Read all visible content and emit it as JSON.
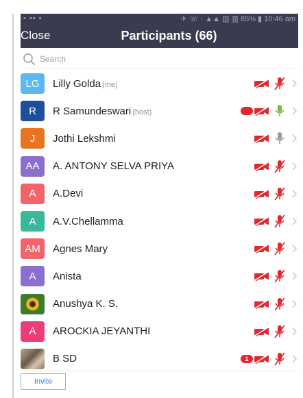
{
  "status_bar": {
    "left": "▪ ▪▪ ▪",
    "right": "✈ ☏ · ▲▲ ▥ ▥ 85% ▮ 10:46 am"
  },
  "header": {
    "close_label": "Close",
    "title": "Participants (66)"
  },
  "search": {
    "placeholder": "Search",
    "icon": "search-icon"
  },
  "colors": {
    "header_bg": "#3b3b4f",
    "muted_red": "#e5262f",
    "unmuted_gray": "#9a9a9a",
    "unmuted_green": "#7ab83f",
    "invite_border": "#7fb6ec"
  },
  "participants": [
    {
      "initials": "LG",
      "name": "Lilly Golda",
      "tag": "(me)",
      "avatar_color": "#5cb8f0",
      "video_off": true,
      "mic": "muted",
      "badge": null
    },
    {
      "initials": "R",
      "name": "R Samundeswari",
      "tag": "(host)",
      "avatar_color": "#1e4f9c",
      "video_off": true,
      "mic": "unmuted-green",
      "badge": ""
    },
    {
      "initials": "J",
      "name": "Jothi Lekshmi",
      "tag": "",
      "avatar_color": "#e8741f",
      "video_off": true,
      "mic": "unmuted-gray",
      "badge": null
    },
    {
      "initials": "AA",
      "name": "A. ANTONY SELVA PRIYA",
      "tag": "",
      "avatar_color": "#8a6fcf",
      "video_off": true,
      "mic": "muted",
      "badge": null
    },
    {
      "initials": "A",
      "name": "A.Devi",
      "tag": "",
      "avatar_color": "#f2646a",
      "video_off": true,
      "mic": "muted",
      "badge": null
    },
    {
      "initials": "A",
      "name": "A.V.Chellamma",
      "tag": "",
      "avatar_color": "#39b89a",
      "video_off": true,
      "mic": "muted",
      "badge": null
    },
    {
      "initials": "AM",
      "name": "Agnes Mary",
      "tag": "",
      "avatar_color": "#f2646a",
      "video_off": true,
      "mic": "muted",
      "badge": null
    },
    {
      "initials": "A",
      "name": "Anista",
      "tag": "",
      "avatar_color": "#8a6fcf",
      "video_off": true,
      "mic": "muted",
      "badge": null
    },
    {
      "initials": "",
      "name": "Anushya K. S.",
      "tag": "",
      "avatar_color": "",
      "avatar_photo": "photo-sunflower",
      "video_off": true,
      "mic": "muted",
      "badge": null
    },
    {
      "initials": "A",
      "name": "AROCKIA JEYANTHI",
      "tag": "",
      "avatar_color": "#ea3d7a",
      "video_off": true,
      "mic": "muted",
      "badge": null
    },
    {
      "initials": "",
      "name": "B SD",
      "tag": "",
      "avatar_color": "",
      "avatar_photo": "photo-person",
      "video_off": true,
      "mic": "muted",
      "badge": "1"
    }
  ],
  "footer": {
    "invite_label": "Invite"
  }
}
